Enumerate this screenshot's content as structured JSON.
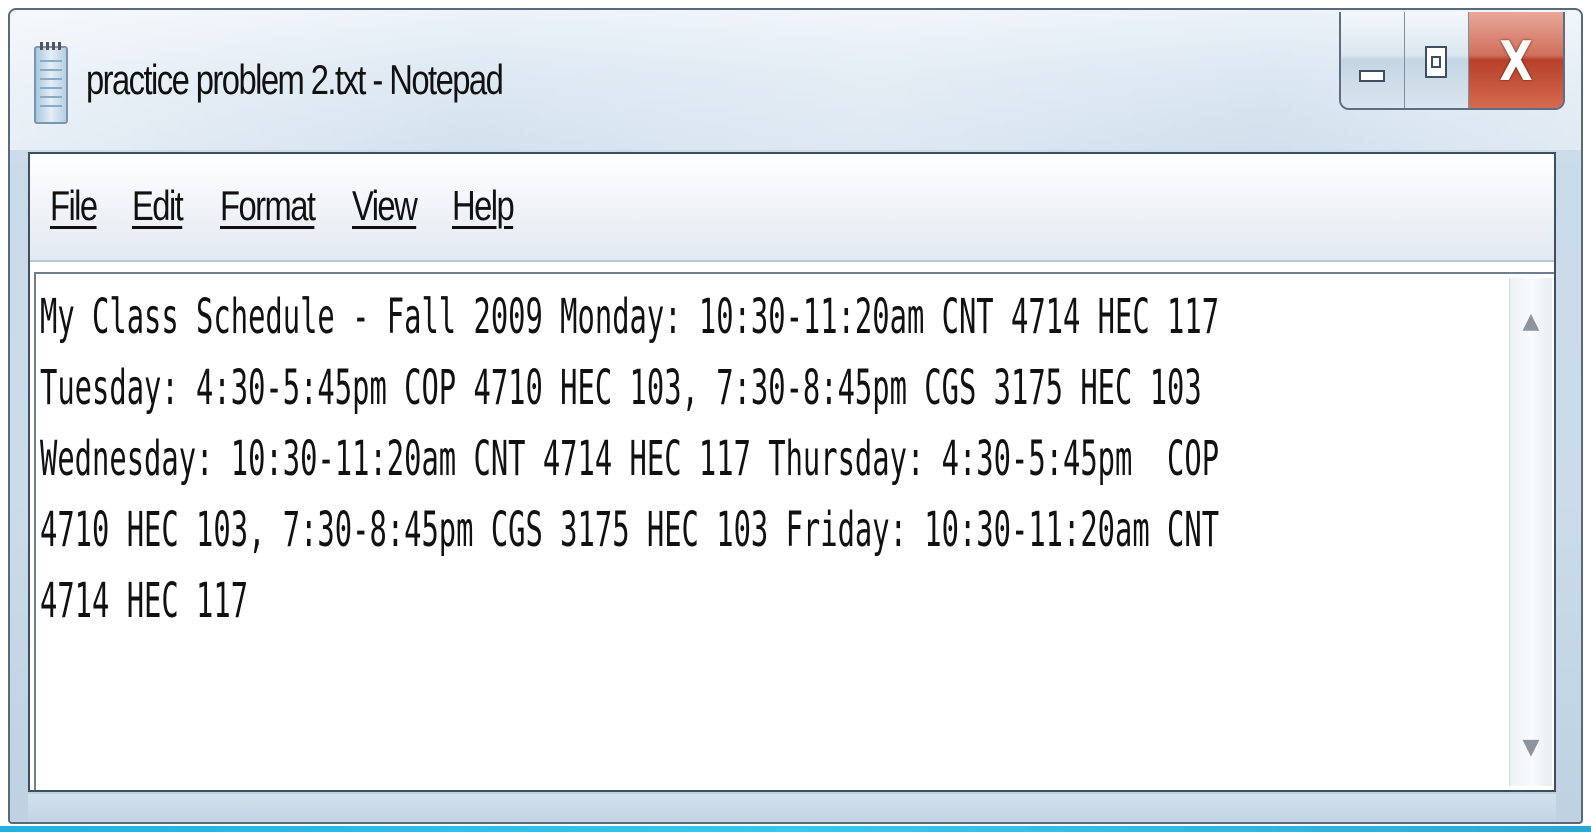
{
  "window": {
    "title": "practice problem 2.txt - Notepad"
  },
  "icons": {
    "app": "notepad-icon",
    "minimize": "minimize-icon",
    "maximize": "maximize-icon",
    "close": "close-icon",
    "scroll_up": "scroll-up-arrow-icon",
    "scroll_down": "scroll-down-arrow-icon"
  },
  "caption": {
    "close_glyph": "X",
    "scroll_up_glyph": "▲",
    "scroll_down_glyph": "▼"
  },
  "menu": {
    "file": "File",
    "edit": "Edit",
    "format": "Format",
    "view": "View",
    "help": "Help"
  },
  "editor": {
    "lines": [
      "My Class Schedule - Fall 2009 Monday: 10:30-11:20am CNT 4714 HEC 117",
      "Tuesday: 4:30-5:45pm COP 4710 HEC 103, 7:30-8:45pm CGS 3175 HEC 103",
      "Wednesday: 10:30-11:20am CNT 4714 HEC 117 Thursday: 4:30-5:45pm  COP",
      "4710 HEC 103, 7:30-8:45pm CGS 3175 HEC 103 Friday: 10:30-11:20am CNT",
      "4714 HEC 117"
    ]
  },
  "colors": {
    "titlebar": "#cbdbe9",
    "close_button": "#c8553e",
    "text": "#111111",
    "accent_strip": "#2ab4e4"
  }
}
